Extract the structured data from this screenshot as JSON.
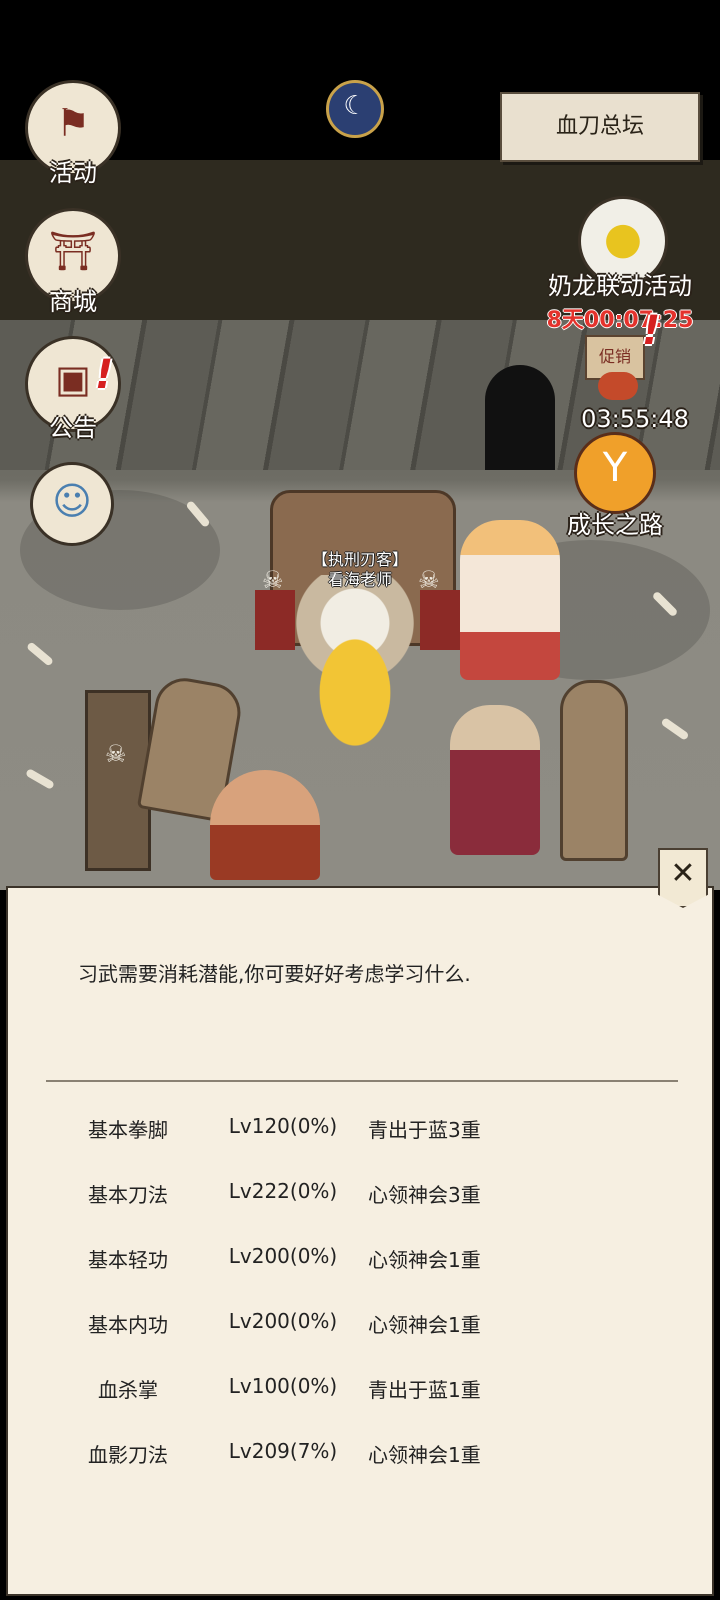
{
  "left_menu": [
    {
      "label": "活动",
      "icon": "flag-icon"
    },
    {
      "label": "商城",
      "icon": "shop-icon"
    },
    {
      "label": "公告",
      "icon": "notice-board-icon"
    },
    {
      "label": "",
      "icon": "character-portrait-icon"
    }
  ],
  "location": {
    "label": "血刀总坛"
  },
  "event": {
    "label": "奶龙联动活动",
    "countdown": "8天00:07:25"
  },
  "promo": {
    "countdown": "03:55:48",
    "badge": "促销"
  },
  "growth": {
    "label": "成长之路"
  },
  "npc": {
    "title": "【执刑刃客】",
    "name": "看海老师"
  },
  "dialog": {
    "prompt": "习武需要消耗潜能,你可要好好考虑学习什么.",
    "skills": [
      {
        "name": "基本拳脚",
        "level": "Lv120(0%)",
        "rank": "青出于蓝3重"
      },
      {
        "name": "基本刀法",
        "level": "Lv222(0%)",
        "rank": "心领神会3重"
      },
      {
        "name": "基本轻功",
        "level": "Lv200(0%)",
        "rank": "心领神会1重"
      },
      {
        "name": "基本内功",
        "level": "Lv200(0%)",
        "rank": "心领神会1重"
      },
      {
        "name": "血杀掌",
        "level": "Lv100(0%)",
        "rank": "青出于蓝1重"
      },
      {
        "name": "血影刀法",
        "level": "Lv209(7%)",
        "rank": "心领神会1重"
      }
    ],
    "close_icon": "close-icon"
  }
}
